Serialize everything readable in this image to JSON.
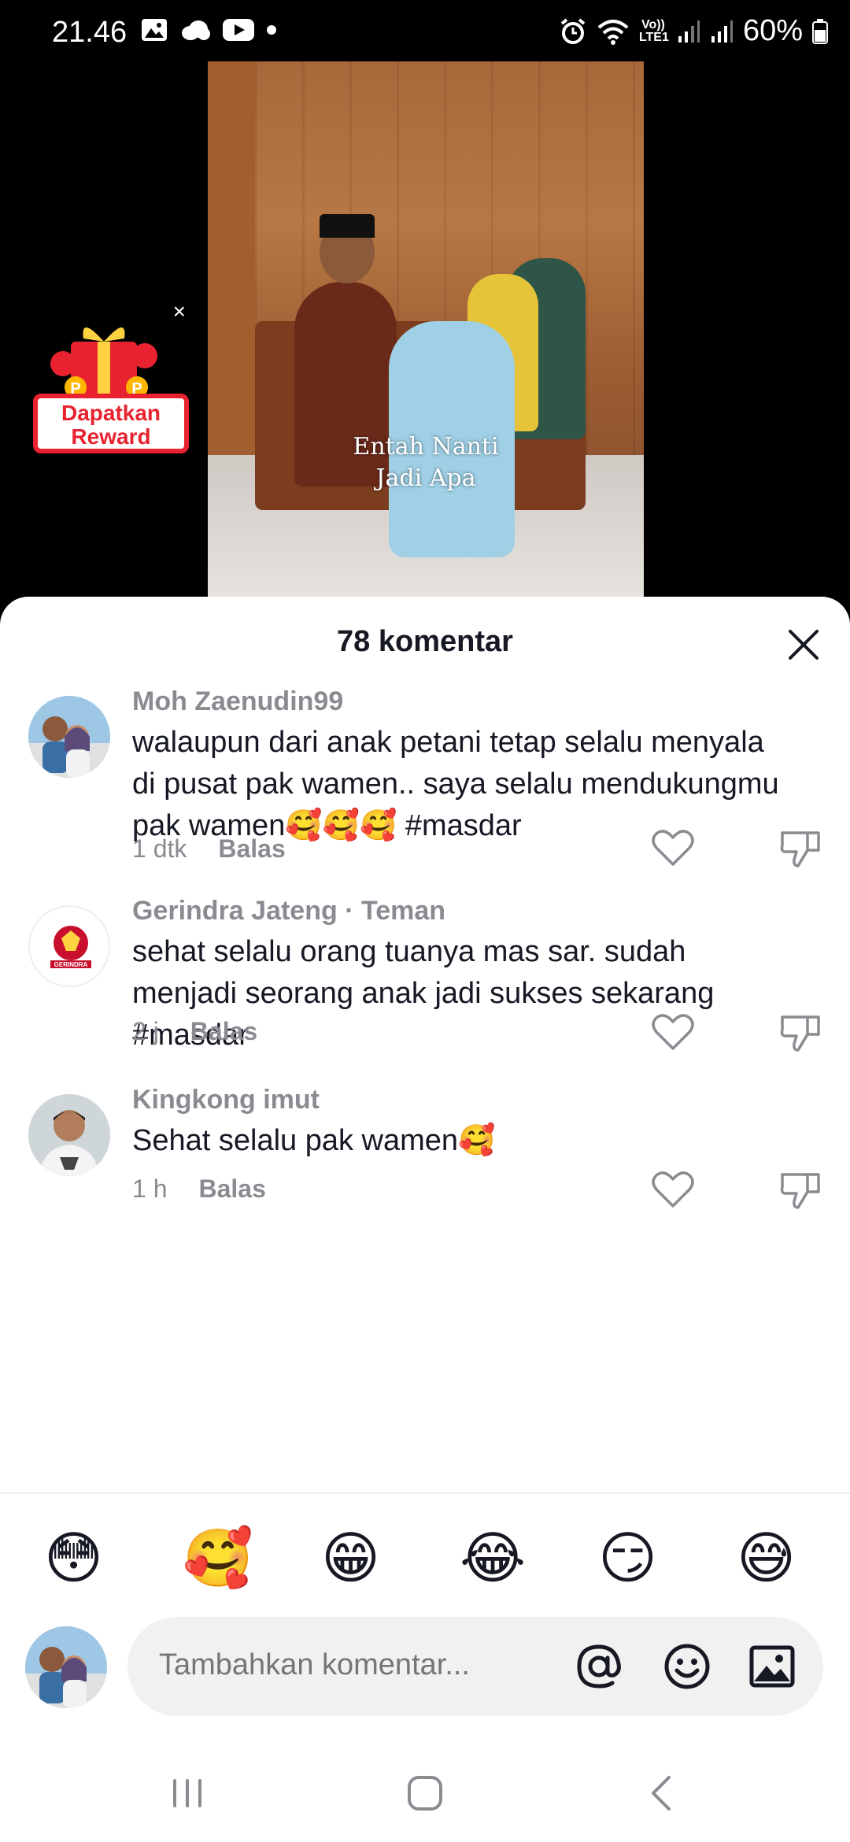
{
  "status_bar": {
    "time": "21.46",
    "battery": "60%",
    "network_label": "Vo)) LTE1",
    "icons_left": [
      "gallery-icon",
      "cloud-icon",
      "youtube-icon",
      "dot-icon"
    ],
    "icons_right": [
      "alarm-icon",
      "wifi-icon",
      "lte-icon",
      "signal-icon",
      "signal-icon",
      "battery-icon"
    ]
  },
  "video": {
    "overlay_line1": "Entah Nanti",
    "overlay_line2": "Jadi Apa"
  },
  "reward": {
    "label": "Dapatkan Reward",
    "close": "×"
  },
  "comments_sheet": {
    "title": "78 komentar",
    "comments": [
      {
        "user": "Moh Zaenudin99",
        "text": "walaupun dari anak petani tetap selalu menyala di pusat pak wamen.. saya selalu mendukungmu pak wamen🥰🥰🥰 #masdar",
        "time": "1 dtk",
        "reply": "Balas"
      },
      {
        "user": "Gerindra Jateng · Teman",
        "text": "sehat selalu orang tuanya mas sar. sudah menjadi seorang anak jadi sukses sekarang #masdar",
        "time": "2 j",
        "reply": "Balas"
      },
      {
        "user": "Kingkong imut",
        "text": "Sehat selalu pak wamen🥰",
        "time": "1 h",
        "reply": "Balas"
      }
    ],
    "quick_emojis": [
      "😳",
      "🥰",
      "😁",
      "😂",
      "😏",
      "😅"
    ],
    "input": {
      "placeholder": "Tambahkan komentar..."
    }
  },
  "colors": {
    "accent_red": "#e8232f",
    "muted_text": "#8a8b91",
    "input_bg": "#f1f1f2"
  }
}
